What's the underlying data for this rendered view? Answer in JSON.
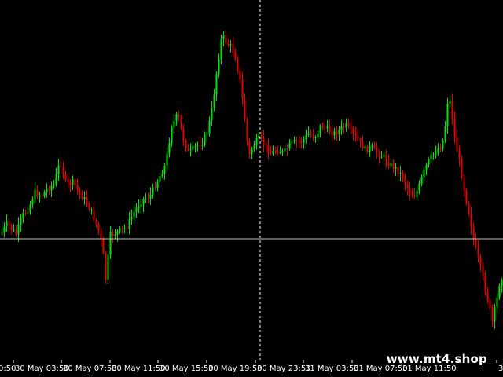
{
  "watermark": "www.mt4.shop",
  "colors": {
    "background": "#000000",
    "bull": "#00e600",
    "bear": "#e60000",
    "crosshair": "#ffffff",
    "axis_text": "#ffffff"
  },
  "chart_data": {
    "type": "candlestick",
    "grid": false,
    "x_tick_labels": [
      "30 May 03:50",
      "30 May 07:50",
      "30 May 11:50",
      "30 May 15:50",
      "30 May 19:50",
      "30 May 23:50",
      "31 May 03:50",
      "31 May 07:50",
      "31 May 11:50"
    ],
    "x_tick_partial_left": "0:50",
    "x_tick_partial_right": "3"
  }
}
